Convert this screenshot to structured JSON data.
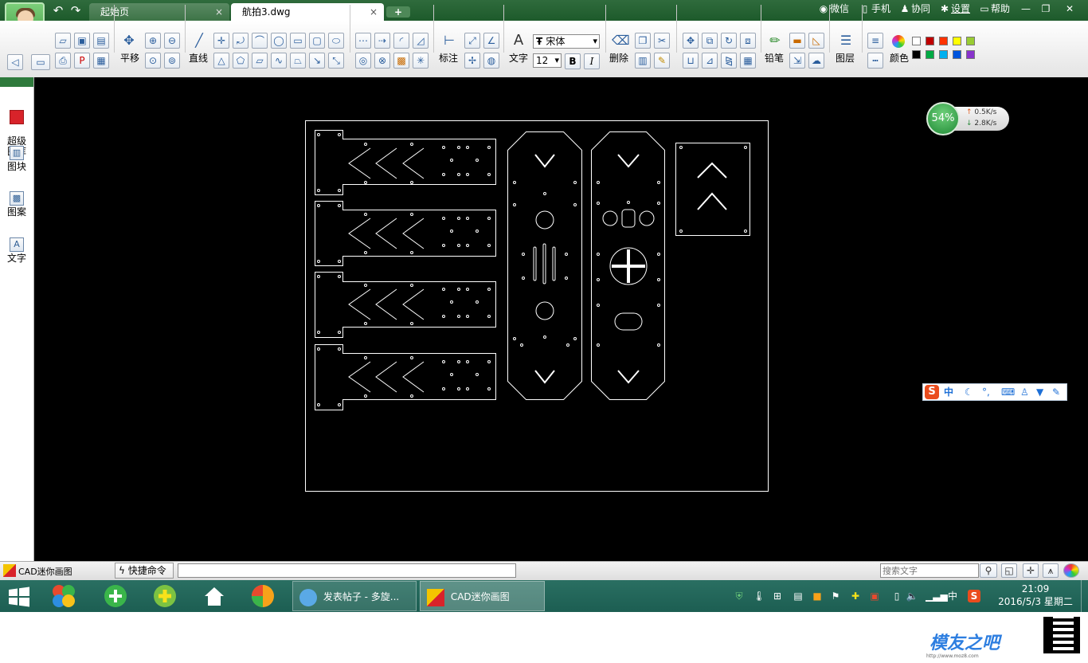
{
  "title_bar": {
    "tabs": [
      {
        "label": "起始页",
        "close": "×"
      },
      {
        "label": "航拍3.dwg",
        "close": "×"
      }
    ],
    "new_tab": "+",
    "links": {
      "wechat": "微信",
      "phone": "手机",
      "collab": "协同",
      "settings": "设置",
      "help": "帮助"
    },
    "window_controls": {
      "minimize": "—",
      "maximize": "❐",
      "close": "✕"
    }
  },
  "toolbar": {
    "pan": "平移",
    "line": "直线",
    "dimension": "标注",
    "text": "文字",
    "font_name": "宋体",
    "font_size": "12",
    "bold": "B",
    "italic": "I",
    "erase": "删除",
    "pencil": "铅笔",
    "layer": "图层",
    "color": "颜色",
    "colors": [
      "#ffffff",
      "#c00000",
      "#ff3300",
      "#ffff00",
      "#99cc33",
      "#000000",
      "#00aa44",
      "#00b0f0",
      "#0055dd",
      "#8833cc"
    ]
  },
  "sidebar": {
    "items": [
      {
        "label": "超级\n图库",
        "icon": "gallery-icon"
      },
      {
        "label": "图块",
        "icon": "block-icon"
      },
      {
        "label": "图案",
        "icon": "pattern-icon"
      },
      {
        "label": "文字",
        "icon": "text-icon"
      }
    ]
  },
  "net_widget": {
    "percent": "54%",
    "up": "0.5K/s",
    "down": "2.8K/s"
  },
  "ime": {
    "logo": "S",
    "mode": "中"
  },
  "status_bar": {
    "app_name": "CAD迷你画图",
    "quick_cmd": "快捷命令",
    "command_value": "",
    "search_placeholder": "搜索文字"
  },
  "taskbar": {
    "tasks": [
      {
        "label": "发表帖子 - 多旋..."
      },
      {
        "label": "CAD迷你画图"
      }
    ],
    "ime_tray": "中",
    "time": "21:09",
    "date": "2016/5/3 星期二"
  },
  "watermark": {
    "brand": "模友之吧",
    "url": "http://www.moz8.com"
  }
}
